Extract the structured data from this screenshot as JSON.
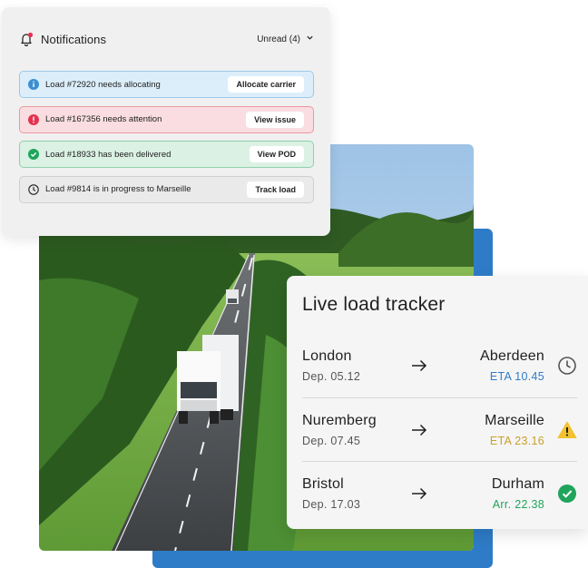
{
  "notifications": {
    "title": "Notifications",
    "filter_label": "Unread (4)",
    "items": [
      {
        "type": "info",
        "text": "Load #72920 needs allocating",
        "action": "Allocate carrier"
      },
      {
        "type": "danger",
        "text": "Load #167356 needs attention",
        "action": "View issue"
      },
      {
        "type": "success",
        "text": "Load #18933 has been delivered",
        "action": "View POD"
      },
      {
        "type": "neutral",
        "text": "Load #9814 is in progress to Marseille",
        "action": "Track load"
      }
    ]
  },
  "tracker": {
    "title": "Live load tracker",
    "trips": [
      {
        "from": "London",
        "departure": "Dep. 05.12",
        "to": "Aberdeen",
        "arrival": "ETA 10.45",
        "status": "in-progress",
        "status_icon": "clock-icon",
        "arrival_color": "#2e7cc7"
      },
      {
        "from": "Nuremberg",
        "departure": "Dep. 07.45",
        "to": "Marseille",
        "arrival": "ETA 23.16",
        "status": "warning",
        "status_icon": "warning-icon",
        "arrival_color": "#c9a227"
      },
      {
        "from": "Bristol",
        "departure": "Dep. 17.03",
        "to": "Durham",
        "arrival": "Arr. 22.38",
        "status": "delivered",
        "status_icon": "check-circle-icon",
        "arrival_color": "#1fa45c"
      }
    ]
  },
  "colors": {
    "info": "#3b8fd1",
    "danger": "#e2334f",
    "success": "#1fa45c",
    "backdrop_blue": "#2e7cc7"
  }
}
